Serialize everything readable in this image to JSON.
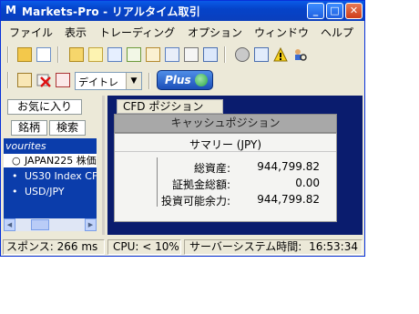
{
  "window": {
    "title": "Markets-Pro - リアルタイム取引",
    "app_icon_glyph": "M",
    "controls": {
      "minimize": "_",
      "maximize": "□",
      "close": "✕"
    }
  },
  "menu": [
    "ファイル",
    "表示",
    "トレーディング",
    "オプション",
    "ウィンドウ",
    "ヘルプ"
  ],
  "toolbar": {
    "row1_icons": [
      "folder-open-icon",
      "envelope-icon",
      "folder-icon",
      "window-icon",
      "panel-icon",
      "chart-icon",
      "table-icon",
      "list-icon",
      "report-icon",
      "export-icon",
      "phone-icon",
      "grid-icon",
      "warning-icon",
      "user-search-icon"
    ],
    "row2_icons": [
      "order-add-icon",
      "order-delete-icon",
      "order-list-icon"
    ],
    "mode_select": {
      "value": "デイトレ",
      "arrow": "▼"
    },
    "plus_button": {
      "label": "Plus"
    }
  },
  "left_pane": {
    "favorites_tab": "お気に入り",
    "tabs": [
      "銘柄",
      "検索"
    ],
    "list_header": "vourites",
    "items": [
      {
        "bullet": "○",
        "label": "JAPAN225 株価",
        "selected": true
      },
      {
        "bullet": "•",
        "label": "US30 Index CF",
        "selected": false
      },
      {
        "bullet": "•",
        "label": "USD/JPY",
        "selected": false
      }
    ],
    "scroll_arrows": {
      "left": "◀",
      "right": "▶"
    }
  },
  "right_pane": {
    "tab": "CFD ポジション",
    "section_header": "キャッシュポジション",
    "summary_title": "サマリー (JPY)",
    "rows": [
      {
        "label": "総資産:",
        "value": "944,799.82"
      },
      {
        "label": "証拠金総額:",
        "value": "0.00"
      },
      {
        "label": "投資可能余力:",
        "value": "944,799.82"
      }
    ]
  },
  "status": {
    "response": "スポンス:  266 ms",
    "cpu": "CPU:  < 10%",
    "server_time_label": "サーバーシステム時間:",
    "server_time": "16:53:34"
  },
  "colors": {
    "title_blue": "#0a4fd6",
    "list_blue": "#0b3dab",
    "dark_pane": "#0a1c6e"
  }
}
